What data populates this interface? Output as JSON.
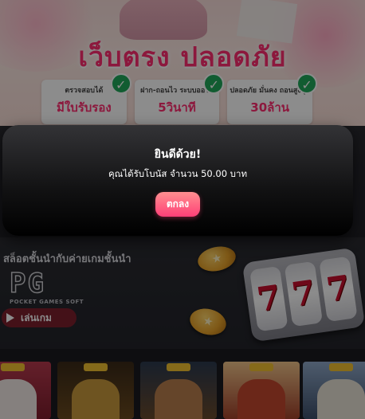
{
  "hero": {
    "title": "เว็บตรง ปลอดภัย",
    "features": [
      {
        "top": "ตรวจสอบได้",
        "big": "มีใบรับรอง"
      },
      {
        "top": "ฝาก-ถอนไว ระบบออโต้",
        "big": "5วินาที"
      },
      {
        "top": "ปลอดภัย มั่นคง ถอนสูงสุด",
        "big": "30ล้าน"
      }
    ]
  },
  "slots": {
    "title": "สล็อตชั้นนำกับค่ายเกมชั้นนำ",
    "provider_logo": "PG",
    "provider_sub": "POCKET GAMES SOFT",
    "play_label": "เล่นเกม",
    "reels": [
      "7",
      "7",
      "7"
    ]
  },
  "modal": {
    "title": "ยินดีด้วย!",
    "message": "คุณได้รับโบนัส จำนวน 50.00 บาท",
    "ok_label": "ตกลง"
  },
  "colors": {
    "accent_pink": "#ff3f77",
    "brand_pink": "#ff2d6f",
    "check_green": "#1fa85a",
    "play_button": "#7c1f2c"
  },
  "icons": {
    "check": "check-icon",
    "play": "play-icon",
    "coin": "coin-icon"
  }
}
